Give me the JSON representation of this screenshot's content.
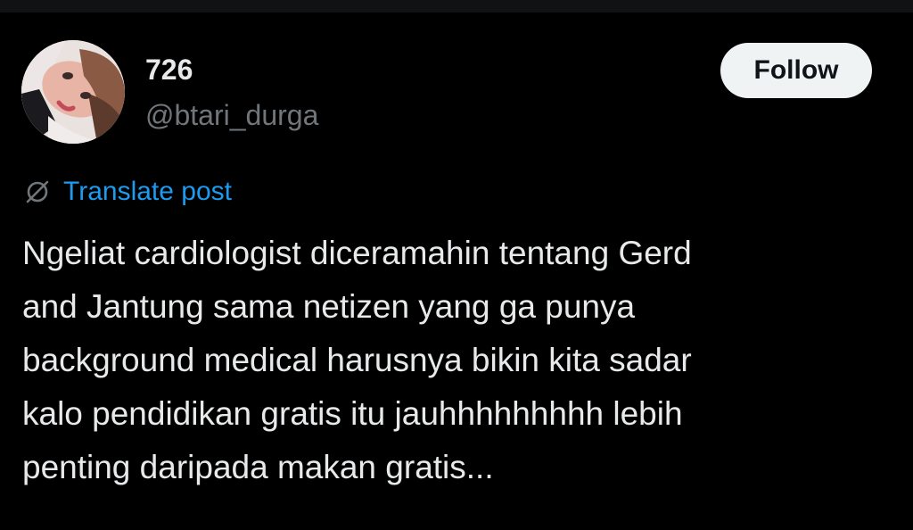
{
  "colors": {
    "background": "#000000",
    "primary_text": "#e7e9ea",
    "secondary_text": "#71767b",
    "link": "#1d9bf0",
    "follow_button_bg": "#eff3f4",
    "follow_button_text": "#0f1419"
  },
  "author": {
    "display_name": "726",
    "handle": "@btari_durga",
    "avatar_icon": "profile-photo"
  },
  "follow_button": {
    "label": "Follow"
  },
  "translate": {
    "icon": "globe-slash-icon",
    "label": "Translate post"
  },
  "post": {
    "lines": [
      "Ngeliat cardiologist diceramahin tentang Gerd",
      "and Jantung sama netizen yang ga punya",
      "background medical harusnya bikin kita sadar",
      "kalo pendidikan gratis itu jauhhhhhhhhh lebih",
      "penting daripada makan gratis..."
    ]
  }
}
